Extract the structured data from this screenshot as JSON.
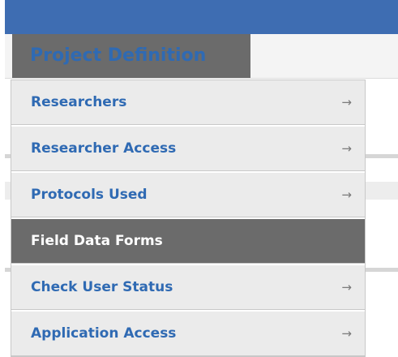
{
  "nav": {
    "tab_label": "Project Definition"
  },
  "menu": {
    "items": [
      {
        "label": "Researchers",
        "arrow": "→"
      },
      {
        "label": "Researcher Access",
        "arrow": "→"
      },
      {
        "label": "Protocols Used",
        "arrow": "→"
      },
      {
        "label": "Field Data Forms",
        "arrow": ""
      },
      {
        "label": "Check User Status",
        "arrow": "→"
      },
      {
        "label": "Application Access",
        "arrow": "→"
      }
    ]
  },
  "colors": {
    "top_bar": "#3e6db2",
    "tab_bg": "#6b6b6b",
    "link_text": "#2f6ab3",
    "item_bg": "#ebebeb",
    "active_bg": "#6b6b6b"
  },
  "icons": {
    "submenu_arrow": "arrow-right-icon"
  }
}
